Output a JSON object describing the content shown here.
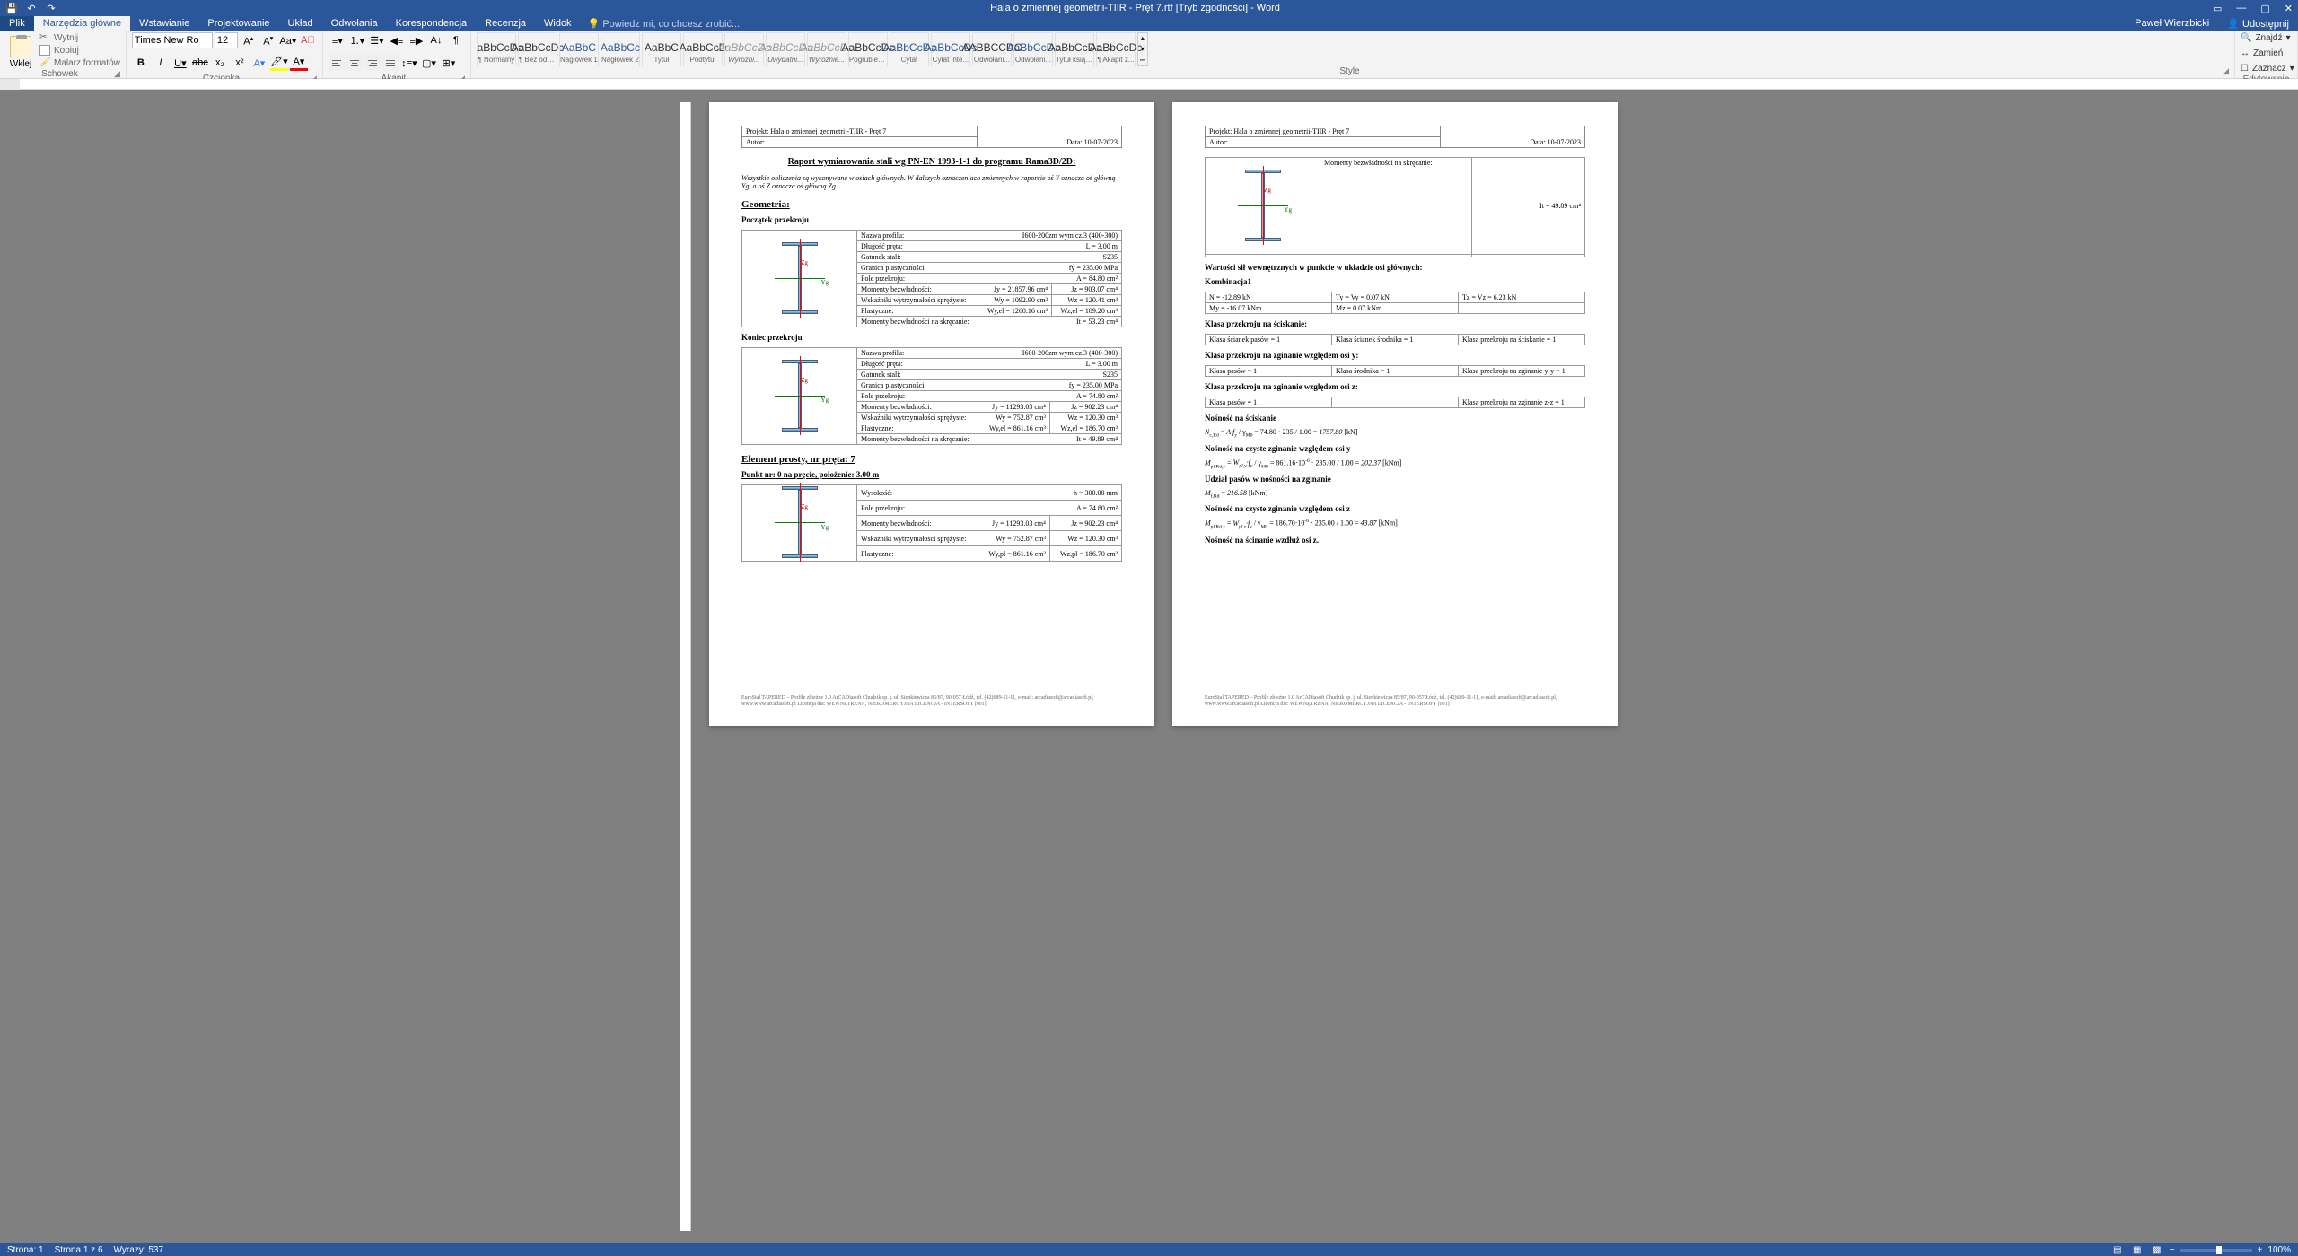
{
  "titlebar": {
    "title": "Hala o zmiennej geometrii-TIIR - Pręt 7.rtf [Tryb zgodności] - Word"
  },
  "tabs": {
    "plik": "Plik",
    "narzedzia_glowne": "Narzędzia główne",
    "wstawianie": "Wstawianie",
    "projektowanie": "Projektowanie",
    "uklad": "Układ",
    "odwolania": "Odwołania",
    "korespondencja": "Korespondencja",
    "recenzja": "Recenzja",
    "widok": "Widok",
    "tell_me": "Powiedz mi, co chcesz zrobić...",
    "user": "Paweł Wierzbicki",
    "share": "Udostępnij"
  },
  "ribbon": {
    "clipboard": {
      "label": "Schowek",
      "paste": "Wklej",
      "cut": "Wytnij",
      "copy": "Kopiuj",
      "format_painter": "Malarz formatów"
    },
    "font": {
      "label": "Czcionka",
      "name": "Times New Ro",
      "size": "12"
    },
    "paragraph": {
      "label": "Akapit"
    },
    "styles": {
      "label": "Style",
      "items": [
        {
          "preview": "AaBbCcDc",
          "name": "¶ Normalny",
          "color": ""
        },
        {
          "preview": "AaBbCcDc",
          "name": "¶ Bez odst...",
          "color": ""
        },
        {
          "preview": "AaBbC",
          "name": "Nagłówek 1",
          "color": "blue"
        },
        {
          "preview": "AaBbCc",
          "name": "Nagłówek 2",
          "color": "blue"
        },
        {
          "preview": "AaBbC",
          "name": "Tytuł",
          "color": ""
        },
        {
          "preview": "AaBbCcD",
          "name": "Podtytuł",
          "color": ""
        },
        {
          "preview": "AaBbCcDc",
          "name": "Wyróżni...",
          "color": "italic"
        },
        {
          "preview": "AaBbCcDc",
          "name": "Uwydatni...",
          "color": "italic"
        },
        {
          "preview": "AaBbCcDc",
          "name": "Wyróżnie...",
          "color": "italic"
        },
        {
          "preview": "AaBbCcDc",
          "name": "Pogrubienie",
          "color": ""
        },
        {
          "preview": "AaBbCcDc",
          "name": "Cytat",
          "color": "blue"
        },
        {
          "preview": "AaBbCcDc",
          "name": "Cytat inte...",
          "color": "blue"
        },
        {
          "preview": "AABBCCDC",
          "name": "Odwołani...",
          "color": ""
        },
        {
          "preview": "AaBbCcDc",
          "name": "Odwołani...",
          "color": "blue"
        },
        {
          "preview": "AaBbCcDc",
          "name": "Tytuł książki",
          "color": ""
        },
        {
          "preview": "AaBbCcDc",
          "name": "¶ Akapit z...",
          "color": ""
        }
      ]
    },
    "editing": {
      "label": "Edytowanie",
      "find": "Znajdź",
      "replace": "Zamień",
      "select": "Zaznacz"
    }
  },
  "statusbar": {
    "page_simple": "Strona: 1",
    "page_of": "Strona 1 z 6",
    "words": "Wyrazy: 537",
    "zoom": "100%"
  },
  "doc": {
    "header": {
      "project_label": "Projekt:",
      "project_name": "Hala o zmiennej geometrii-TIIR - Pręt 7",
      "author_label": "Autor:",
      "date_label": "Data:",
      "date": "10-07-2023"
    },
    "title": "Raport wymiarowania stali wg PN-EN 1993-1-1 do programu Rama3D/2D:",
    "intro": "Wszystkie obliczenia są wykonywane w osiach głównych. W dalszych oznaczeniach zmiennych w raporcie oś Y oznacza oś główną Yg, a oś Z oznacza oś główną Zg.",
    "sec_geometria": "Geometria:",
    "sec_poczatek": "Początek przekroju",
    "sec_koniec": "Koniec przekroju",
    "sec_element": "Element prosty, nr pręta: 7",
    "sec_punkt": "Punkt nr: 0 na pręcie, położenie: 3.00 m",
    "rows_start": [
      [
        "Nazwa profilu:",
        "",
        "I600-200zm wym cz.3 (400-300)"
      ],
      [
        "Długość pręta:",
        "",
        "L = 3.00 m"
      ],
      [
        "Gatunek stali:",
        "",
        "S235"
      ],
      [
        "Granica plastyczności:",
        "",
        "fy = 235.00 MPa"
      ],
      [
        "Pole przekroju:",
        "",
        "A = 84.80 cm²"
      ],
      [
        "Momenty bezwładności:",
        "Jy = 21857.96 cm⁴",
        "Jz = 903.07 cm⁴"
      ],
      [
        "Wskaźniki wytrzymałości sprężyste:",
        "Wy = 1092.90 cm³",
        "Wz = 120.41 cm³"
      ],
      [
        "Plastyczne:",
        "Wy,el = 1260.16 cm³",
        "Wz,el = 189.20 cm³"
      ],
      [
        "Momenty bezwładności na skręcanie:",
        "",
        "It = 53.23 cm⁴"
      ]
    ],
    "rows_end": [
      [
        "Nazwa profilu:",
        "",
        "I600-200zm wym cz.3 (400-300)"
      ],
      [
        "Długość pręta:",
        "",
        "L = 3.00 m"
      ],
      [
        "Gatunek stali:",
        "",
        "S235"
      ],
      [
        "Granica plastyczności:",
        "",
        "fy = 235.00 MPa"
      ],
      [
        "Pole przekroju:",
        "",
        "A = 74.80 cm²"
      ],
      [
        "Momenty bezwładności:",
        "Jy = 11293.03 cm⁴",
        "Jz = 902.23 cm⁴"
      ],
      [
        "Wskaźniki wytrzymałości sprężyste:",
        "Wy = 752.87 cm³",
        "Wz = 120.30 cm³"
      ],
      [
        "Plastyczne:",
        "Wy,el = 861.16 cm³",
        "Wz,el = 186.70 cm³"
      ],
      [
        "Momenty bezwładności na skręcanie:",
        "",
        "It = 49.89 cm⁴"
      ]
    ],
    "rows_punkt": [
      [
        "Wysokość:",
        "",
        "h = 300.00 mm"
      ],
      [
        "Pole przekroju:",
        "",
        "A = 74.80 cm²"
      ],
      [
        "Momenty bezwładności:",
        "Jy = 11293.03 cm⁴",
        "Jz = 902.23 cm⁴"
      ],
      [
        "Wskaźniki wytrzymałości sprężyste:",
        "Wy = 752.87 cm³",
        "Wz = 120.30 cm³"
      ],
      [
        "Plastyczne:",
        "Wy,pl = 861.16 cm³",
        "Wz,pl = 186.70 cm³"
      ]
    ],
    "page2": {
      "momenty_row": [
        "Momenty bezwładności na skręcanie:",
        "It = 49.89 cm⁴"
      ],
      "sec_wartosci": "Wartości sił wewnętrznych w punkcie w układzie osi głównych:",
      "kombinacja": "Kombinacja1",
      "forces": [
        [
          "N = -12.89 kN",
          "Ty = Vy = 0.07 kN",
          "Tz = Vz = 6.23 kN"
        ],
        [
          "My = -16.07 kNm",
          "Mz = 0.07 kNm",
          ""
        ]
      ],
      "sec_klasa_sciskanie": "Klasa przekroju na ściskanie:",
      "klasa_sciskanie": [
        "Klasa ścianek pasów = 1",
        "Klasa ścianek środnika = 1",
        "Klasa przekroju na ściskanie = 1"
      ],
      "sec_klasa_zgy": "Klasa przekroju na zginanie względem osi y:",
      "klasa_zgy": [
        "Klasa pasów = 1",
        "Klasa środnika = 1",
        "Klasa przekroju na zginanie y-y = 1"
      ],
      "sec_klasa_zgz": "Klasa przekroju na zginanie względem osi z:",
      "klasa_zgz": [
        "Klasa pasów = 1",
        "",
        "Klasa przekroju na zginanie z-z = 1"
      ],
      "sec_nosnosc_scisk": "Nośność na ściskanie",
      "formula_scisk": "N_c,Rd = A·fy / γ_M0 = 74.80·235 / 1.00 = 1757.80 [kN]",
      "sec_nosnosc_zgy": "Nośność na czyste zginanie względem osi y",
      "formula_zgy": "M_pl,Rd,y = W_pl,y·fy / γ_M0 = 861.16·10⁻⁶·235.00 / 1.00 = 202.37 [kNm]",
      "sec_udzial": "Udział pasów w nośności na zginanie",
      "formula_udzial": "M_f,Rd = 216.58 [kNm]",
      "sec_nosnosc_zgz": "Nośność na czyste zginanie względem osi z",
      "formula_zgz": "M_pl,Rd,z = W_pl,z·fy / γ_M0 = 186.70·10⁻⁶·235.00 / 1.00 = 43.87 [kNm]",
      "sec_nosnosc_scv": "Nośność na ścinanie wzdłuż osi z."
    },
    "footer": "EuroStal TAPERED – Profile zbieżne 1.0  ArCADiasoft Chudzik sp. j. ul. Sienkiewicza 85/87, 90-057 Łódź, tel. (42)689-11-11, e-mail: arcadiasoft@arcadiasoft.pl, www.www.arcadiasoft.pl\nLicencja dla: WEWNĘTRZNA, NIEKOMERCYJNA LICENCJA - INTERSOFT [001]"
  }
}
